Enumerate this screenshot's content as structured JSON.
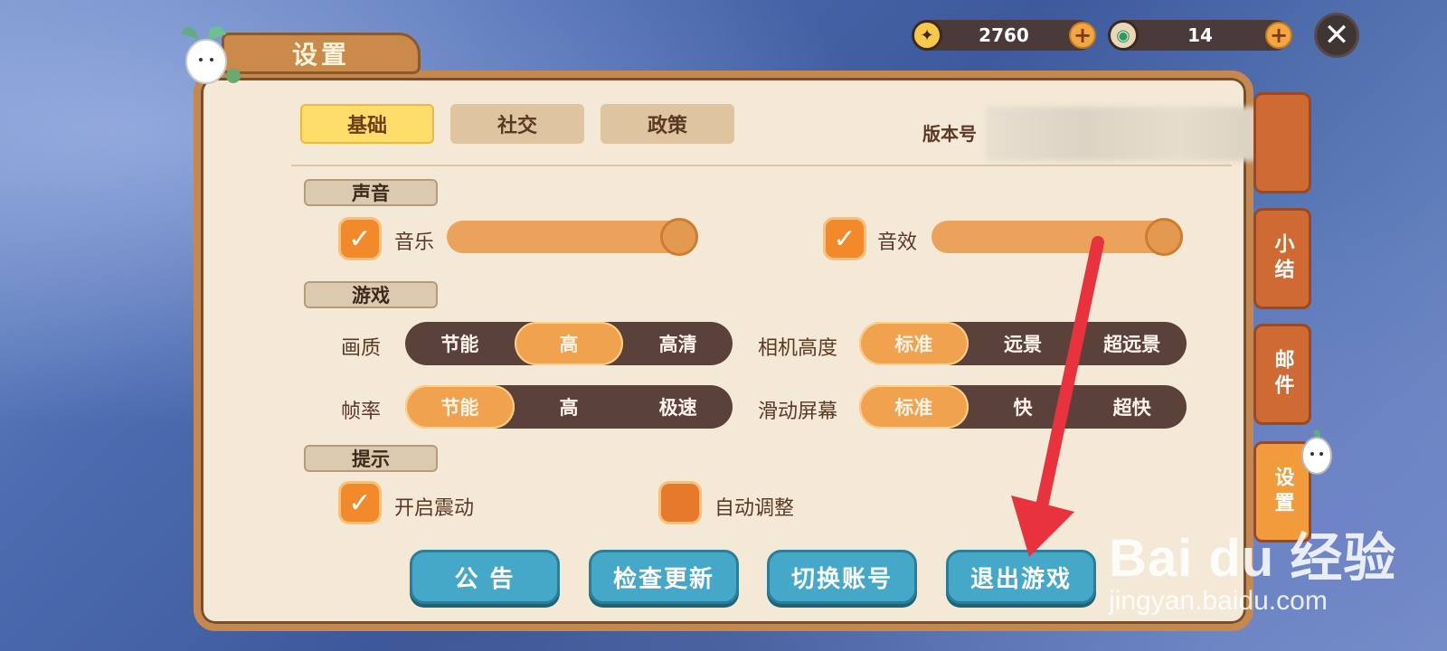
{
  "currency": {
    "gold_amount": "2760",
    "gem_amount": "14"
  },
  "header": {
    "title": "设置"
  },
  "tabs": [
    {
      "label": "基础",
      "active": true
    },
    {
      "label": "社交",
      "active": false
    },
    {
      "label": "政策",
      "active": false
    }
  ],
  "version": {
    "label": "版本号"
  },
  "sections": {
    "sound": "声音",
    "game": "游戏",
    "tips": "提示"
  },
  "sound": {
    "music_label": "音乐",
    "sfx_label": "音效"
  },
  "game": {
    "quality_label": "画质",
    "quality_options": [
      "节能",
      "高",
      "高清"
    ],
    "camera_label": "相机高度",
    "camera_options": [
      "标准",
      "远景",
      "超远景"
    ],
    "framerate_label": "帧率",
    "framerate_options": [
      "节能",
      "高",
      "极速"
    ],
    "scroll_label": "滑动屏幕",
    "scroll_options": [
      "标准",
      "快",
      "超快"
    ]
  },
  "tips": {
    "vibration_label": "开启震动",
    "auto_adjust_label": "自动调整"
  },
  "buttons": {
    "notice": "公 告",
    "check_update": "检查更新",
    "switch_account": "切换账号",
    "exit_game": "退出游戏"
  },
  "side_tabs": {
    "summary": "小结",
    "mail": "邮件",
    "settings": "设置"
  },
  "watermark": {
    "brand": "Bai du 经验",
    "url": "jingyan.baidu.com"
  },
  "colors": {
    "accent_orange": "#f0a24e",
    "panel_bg": "#f3e9d6",
    "button_blue": "#45a8c8",
    "arrow_red": "#e8323e"
  }
}
